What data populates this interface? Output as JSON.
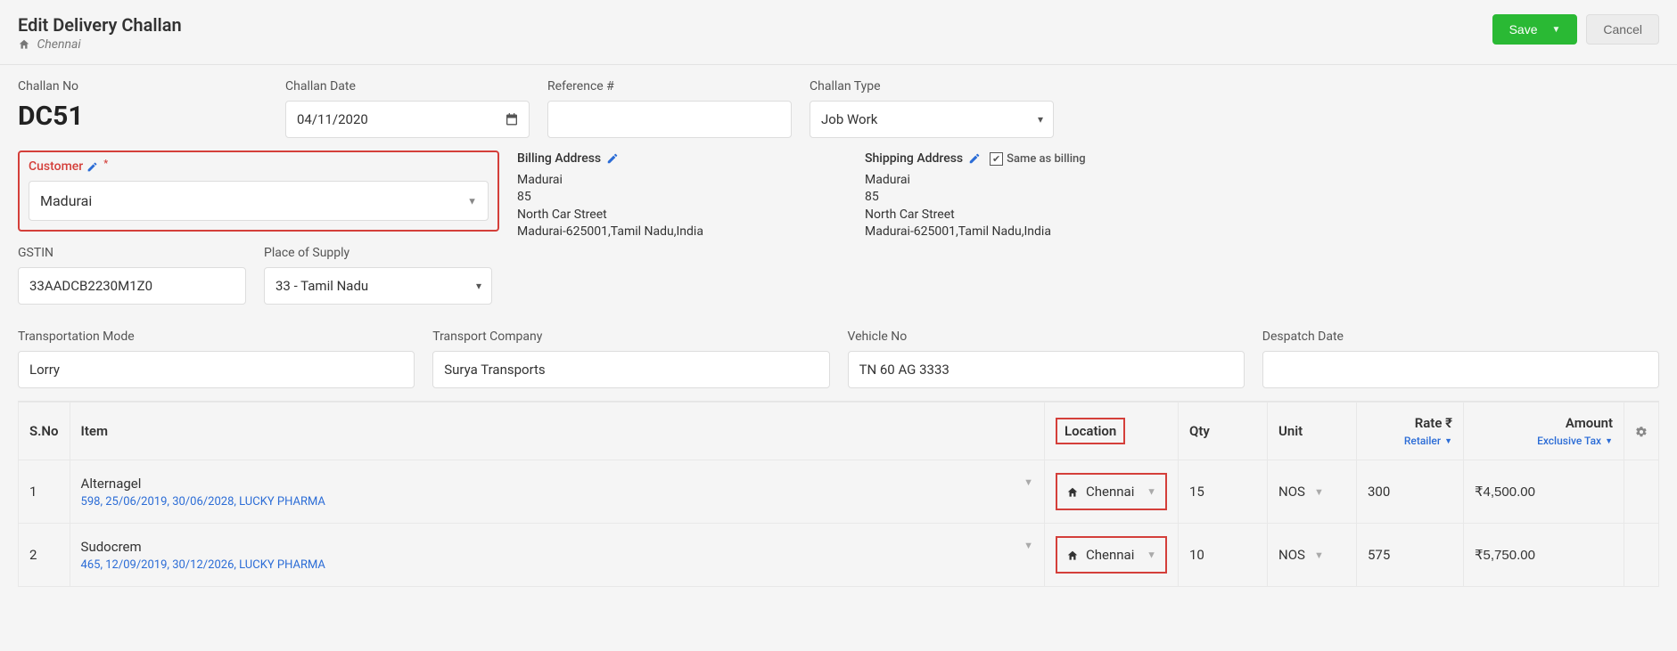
{
  "header": {
    "title": "Edit Delivery Challan",
    "location": "Chennai",
    "save_label": "Save",
    "cancel_label": "Cancel"
  },
  "fields": {
    "challan_no_label": "Challan No",
    "challan_no_value": "DC51",
    "challan_date_label": "Challan Date",
    "challan_date_value": "04/11/2020",
    "reference_label": "Reference #",
    "reference_value": "",
    "challan_type_label": "Challan Type",
    "challan_type_value": "Job Work"
  },
  "customer": {
    "label": "Customer",
    "value": "Madurai"
  },
  "billing": {
    "title": "Billing Address",
    "line1": "Madurai",
    "line2": "85",
    "line3": "North Car Street",
    "line4": "Madurai-625001,Tamil Nadu,India"
  },
  "shipping": {
    "title": "Shipping Address",
    "same_label": "Same as billing",
    "line1": "Madurai",
    "line2": "85",
    "line3": "North Car Street",
    "line4": "Madurai-625001,Tamil Nadu,India"
  },
  "gstin": {
    "label": "GSTIN",
    "value": "33AADCB2230M1Z0"
  },
  "place_of_supply": {
    "label": "Place of Supply",
    "value": "33 - Tamil Nadu"
  },
  "transport": {
    "mode_label": "Transportation Mode",
    "mode_value": "Lorry",
    "company_label": "Transport Company",
    "company_value": "Surya Transports",
    "vehicle_label": "Vehicle No",
    "vehicle_value": "TN 60 AG 3333",
    "despatch_label": "Despatch Date",
    "despatch_value": ""
  },
  "table": {
    "headers": {
      "sno": "S.No",
      "item": "Item",
      "location": "Location",
      "qty": "Qty",
      "unit": "Unit",
      "rate": "Rate ₹",
      "rate_sub": "Retailer",
      "amount": "Amount",
      "amount_sub": "Exclusive Tax"
    },
    "rows": [
      {
        "sno": "1",
        "item": "Alternagel",
        "item_detail": "598, 25/06/2019, 30/06/2028, LUCKY PHARMA",
        "location": "Chennai",
        "qty": "15",
        "unit": "NOS",
        "rate": "300",
        "amount": "₹4,500.00"
      },
      {
        "sno": "2",
        "item": "Sudocrem",
        "item_detail": "465, 12/09/2019, 30/12/2026, LUCKY PHARMA",
        "location": "Chennai",
        "qty": "10",
        "unit": "NOS",
        "rate": "575",
        "amount": "₹5,750.00"
      }
    ]
  }
}
